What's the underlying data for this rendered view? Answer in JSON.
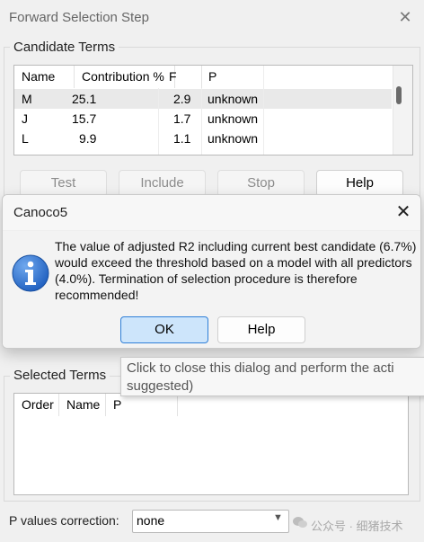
{
  "window": {
    "title": "Forward Selection Step",
    "close_icon": "close-icon"
  },
  "candidate_terms": {
    "legend": "Candidate Terms",
    "columns": [
      "Name",
      "Contribution %",
      "F",
      "P"
    ],
    "rows": [
      {
        "name": "M",
        "contribution": "25.1",
        "f": "2.9",
        "p": "unknown"
      },
      {
        "name": "J",
        "contribution": "15.7",
        "f": "1.7",
        "p": "unknown"
      },
      {
        "name": "L",
        "contribution": "9.9",
        "f": "1.1",
        "p": "unknown"
      }
    ]
  },
  "buttons": {
    "test": "Test",
    "include": "Include",
    "stop": "Stop",
    "help": "Help"
  },
  "selected_terms": {
    "legend": "Selected Terms",
    "columns": [
      "Order",
      "Name",
      "P"
    ]
  },
  "p_values_correction": {
    "label": "P values correction:",
    "value": "none"
  },
  "watermark": "公众号 · 细猪技术",
  "dialog": {
    "title": "Canoco5",
    "message": "The value of adjusted R2 including current best candidate (6.7%) would exceed the threshold based on a model with all predictors (4.0%). Termination of selection procedure is therefore recommended!",
    "ok_label": "OK",
    "help_label": "Help",
    "icon": "info-icon",
    "icon_color": "#1f5fbf"
  },
  "tooltip": {
    "text": "Click to close this dialog and perform the acti\nsuggested)"
  }
}
